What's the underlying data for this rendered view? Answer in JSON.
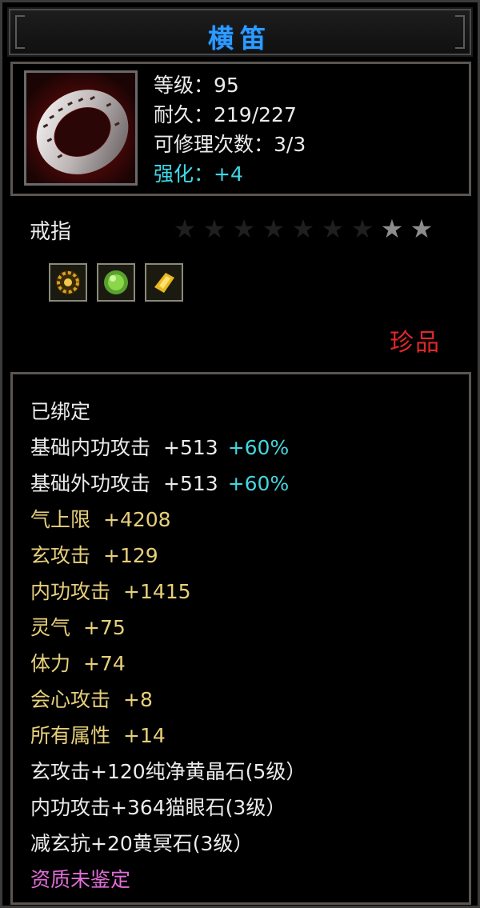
{
  "item": {
    "title": "横笛",
    "level": "等级：95",
    "durability": "耐久：219/227",
    "repair": "可修理次数：3/3",
    "enhance": "强化：+4",
    "type": "戒指",
    "rarity": "珍品",
    "stars_total": 9,
    "stars_lit": 2
  },
  "gems": [
    {
      "name": "orange-gem-icon",
      "color": "#d8a020"
    },
    {
      "name": "green-gem-icon",
      "color": "#7cd040"
    },
    {
      "name": "yellow-gem-icon",
      "color": "#e8c020"
    }
  ],
  "stats": {
    "bound": "已绑定",
    "base_inner_label": "基础内功攻击",
    "base_inner_value": "+513",
    "base_inner_pct": "+60%",
    "base_outer_label": "基础外功攻击",
    "base_outer_value": "+513",
    "base_outer_pct": "+60%",
    "qi_label": "气上限",
    "qi_value": "+4208",
    "xuan_label": "玄攻击",
    "xuan_value": "+129",
    "inner_label": "内功攻击",
    "inner_value": "+1415",
    "spirit_label": "灵气",
    "spirit_value": "+75",
    "stamina_label": "体力",
    "stamina_value": "+74",
    "crit_label": "会心攻击",
    "crit_value": "+8",
    "all_label": "所有属性",
    "all_value": "+14",
    "socket1": "玄攻击+120纯净黄晶石(5级）",
    "socket2": "内功攻击+364猫眼石(3级）",
    "socket3": "减玄抗+20黄冥石(3级）",
    "quality": "资质未鉴定"
  },
  "colors": {
    "title": "#2e9bff",
    "enhance": "#3fd8e6",
    "rarity": "#e0272a",
    "stat": "#e7d07a",
    "quality": "#e26ed9"
  }
}
